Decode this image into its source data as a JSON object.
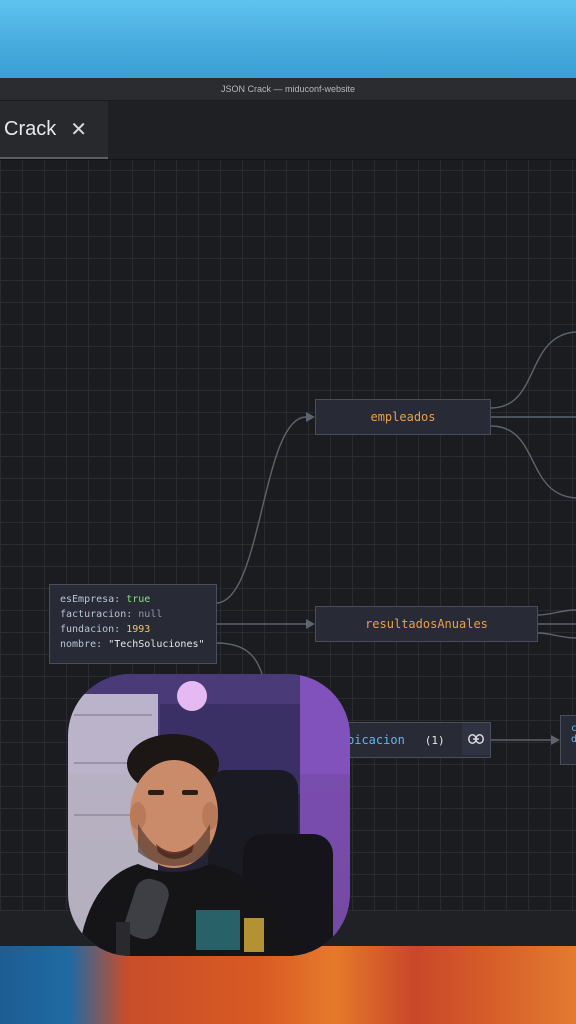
{
  "window": {
    "title": "JSON Crack — miduconf-website"
  },
  "tab": {
    "label": "Crack",
    "close_symbol": "✕"
  },
  "graph": {
    "nodes": {
      "empleados": "empleados",
      "resultados": "resultadosAnuales",
      "ubicacion": "bicacion",
      "ubicacion_count": "(1)",
      "far_right_partial": [
        "c",
        "d"
      ]
    },
    "props": {
      "row1_key": "esEmpresa:",
      "row1_val": "true",
      "row2_key": "facturacion:",
      "row2_val": "null",
      "row3_key": "fundacion:",
      "row3_val": "1993",
      "row4_key": "nombre:",
      "row4_val": "\"TechSoluciones\""
    }
  },
  "colors": {
    "node_title": "#e9a04a",
    "node_bg": "#282a36",
    "edge": "#5d6470",
    "bool_true": "#86e27f",
    "number": "#f3c767",
    "link": "#5eb8ea"
  }
}
